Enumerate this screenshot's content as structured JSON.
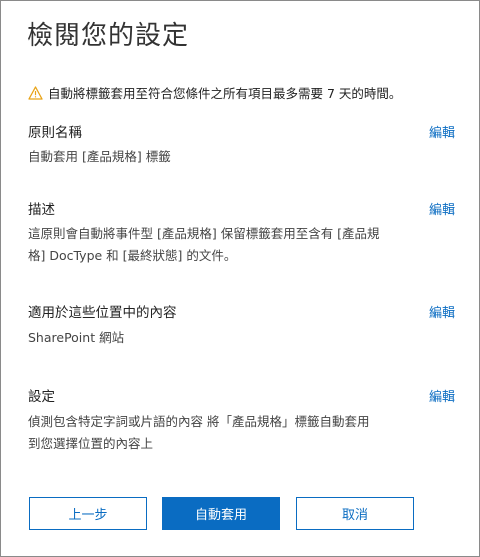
{
  "title": "檢閱您的設定",
  "notice": {
    "icon": "warning-icon",
    "icon_color": "#e8a317",
    "text": "自動將標籤套用至符合您條件之所有項目最多需要 7 天的時間。"
  },
  "sections": [
    {
      "heading": "原則名稱",
      "edit_label": "編輯",
      "lines": [
        "自動套用 [產品規格] 標籤"
      ]
    },
    {
      "heading": "描述",
      "edit_label": "編輯",
      "lines": [
        "這原則會自動將事件型 [產品規格] 保留標籤套用至含有 [產品規",
        "格] DocType 和 [最終狀態] 的文件。"
      ]
    },
    {
      "heading": "適用於這些位置中的內容",
      "edit_label": "編輯",
      "lines": [
        "SharePoint 網站"
      ]
    },
    {
      "heading": "設定",
      "edit_label": "編輯",
      "lines": [
        "偵測包含特定字詞或片語的內容 將「產品規格」標籤自動套用",
        "到您選擇位置的內容上"
      ]
    }
  ],
  "buttons": {
    "back": "上一步",
    "submit": "自動套用",
    "cancel": "取消"
  },
  "colors": {
    "accent": "#0a6cc2"
  }
}
